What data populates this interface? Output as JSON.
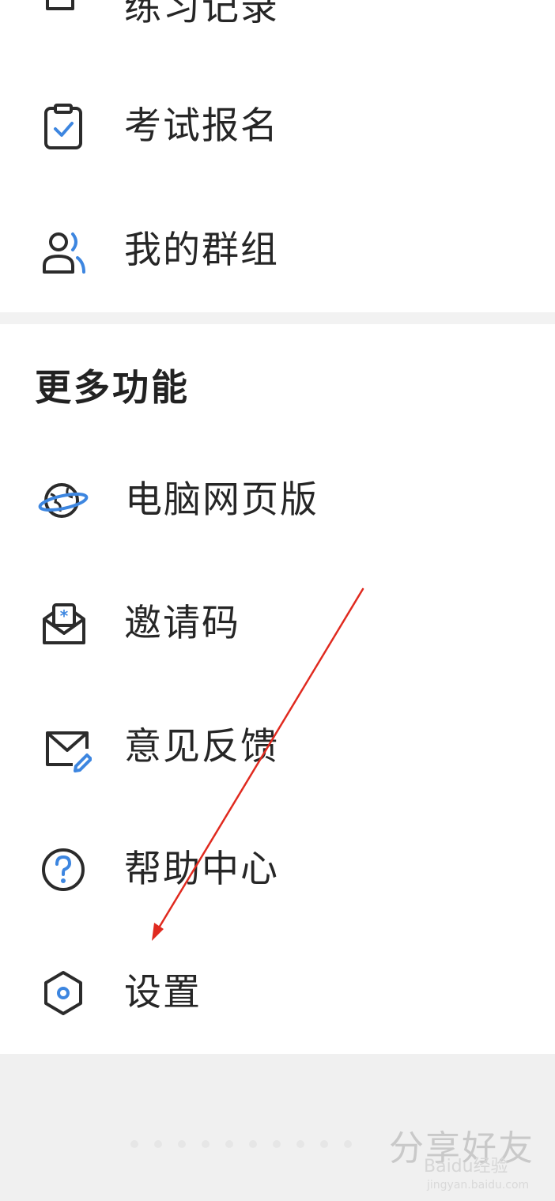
{
  "menu_top": {
    "items": [
      {
        "label": "练习记录",
        "icon": "practice-record-icon"
      },
      {
        "label": "考试报名",
        "icon": "exam-registration-icon"
      },
      {
        "label": "我的群组",
        "icon": "my-groups-icon"
      }
    ]
  },
  "more_features": {
    "title": "更多功能",
    "items": [
      {
        "label": "电脑网页版",
        "icon": "web-globe-icon"
      },
      {
        "label": "邀请码",
        "icon": "invite-code-icon"
      },
      {
        "label": "意见反馈",
        "icon": "feedback-mail-icon"
      },
      {
        "label": "帮助中心",
        "icon": "help-question-icon"
      },
      {
        "label": "设置",
        "icon": "settings-hexagon-icon"
      }
    ]
  },
  "watermark": {
    "text": "分享好友",
    "logo_text": "Baidu经验",
    "url": "jingyan.baidu.com"
  },
  "colors": {
    "icon_dark": "#2b2b2b",
    "icon_accent": "#3d86e0",
    "annotation_arrow": "#e02a1f",
    "background_gray": "#f2f2f2"
  }
}
